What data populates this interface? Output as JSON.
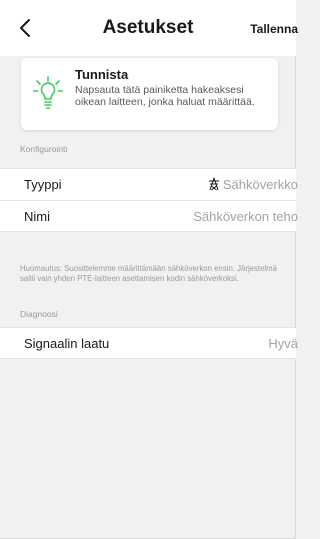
{
  "header": {
    "title": "Asetukset",
    "save_label": "Tallenna",
    "back_icon": "chevron-left-icon"
  },
  "identify": {
    "title": "Tunnista",
    "description": "Napsauta tätä painiketta hakeaksesi oikean laitteen, jonka haluat määrittää.",
    "icon": "lightbulb-icon",
    "icon_color": "#3dcd58"
  },
  "configuration": {
    "section_label": "Konfigurointi",
    "type_label": "Tyyppi",
    "type_value": "Sähköverkko",
    "type_icon": "power-pylon-icon",
    "name_label": "Nimi",
    "name_placeholder": "Sähköverkon teho",
    "note": "Huomautus: Suosittelemme määrittämään sähköverkon ensin. Järjestelmä sallii vain yhden PTE-laitteen asettamisen kodin sähköverkoksi."
  },
  "diagnostics": {
    "section_label": "Diagnoosi",
    "signal_label": "Signaalin laatu",
    "signal_value": "Hyvä"
  },
  "colors": {
    "accent": "#3dcd58",
    "background": "#f1f1f2",
    "card": "#ffffff",
    "muted_text": "#a3a3a3"
  }
}
